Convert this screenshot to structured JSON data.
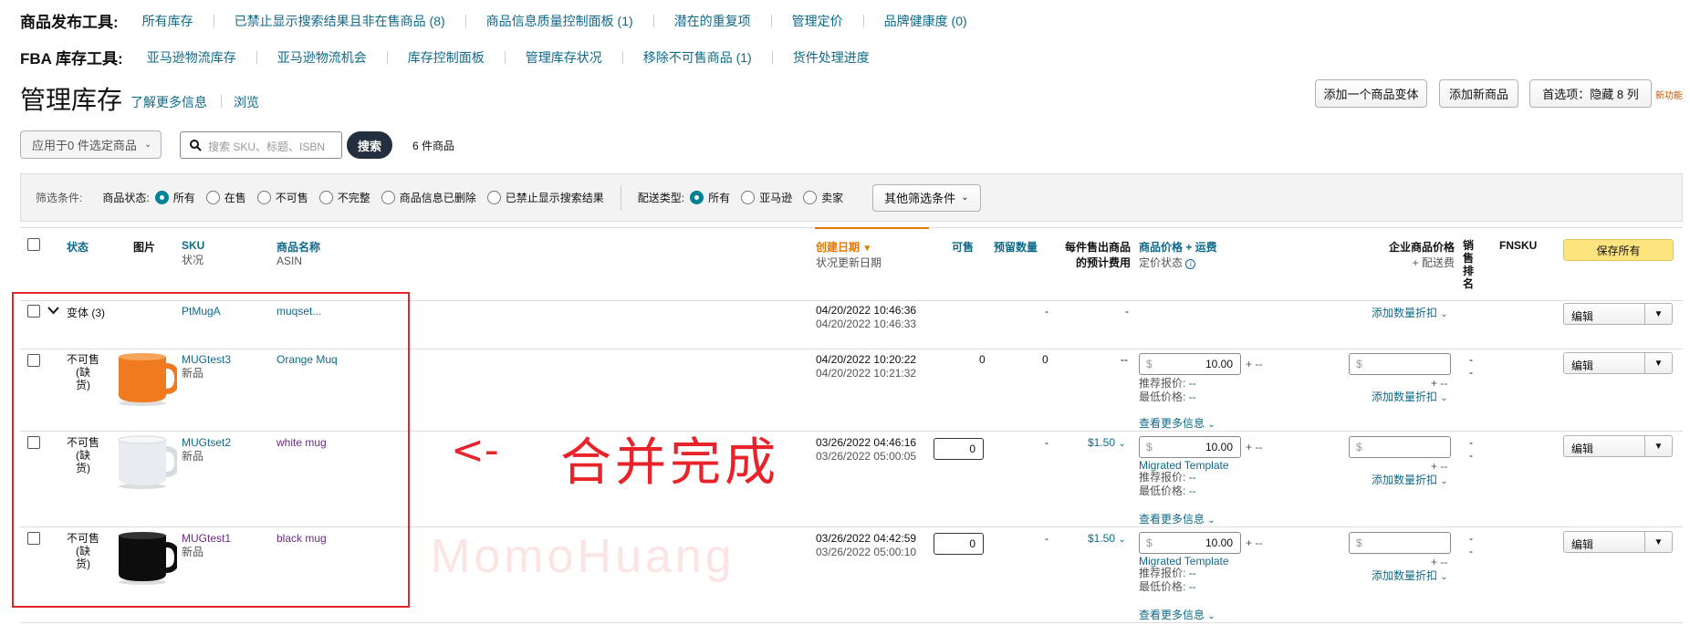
{
  "publish_tools": {
    "title": "商品发布工具:",
    "links": [
      "所有库存",
      "已禁止显示搜索结果且非在售商品 (8)",
      "商品信息质量控制面板 (1)",
      "潜在的重复项",
      "管理定价",
      "品牌健康度 (0)"
    ]
  },
  "fba_tools": {
    "title": "FBA 库存工具:",
    "links": [
      "亚马逊物流库存",
      "亚马逊物流机会",
      "库存控制面板",
      "管理库存状况",
      "移除不可售商品 (1)",
      "货件处理进度"
    ]
  },
  "page": {
    "title": "管理库存",
    "learn_more": "了解更多信息",
    "browse": "浏览",
    "btn_add_variation": "添加一个商品变体",
    "btn_add_product": "添加新商品",
    "btn_prefs": "首选项：隐藏 8 列",
    "new_feature": "新功能"
  },
  "search": {
    "apply_label": "应用于0 件选定商品",
    "placeholder": "搜索 SKU、标题、ISBN",
    "button": "搜索",
    "count": "6 件商品"
  },
  "filters": {
    "label": "筛选条件:",
    "status_label": "商品状态:",
    "status_options": [
      "所有",
      "在售",
      "不可售",
      "不完整",
      "商品信息已删除",
      "已禁止显示搜索结果"
    ],
    "fulfill_label": "配送类型:",
    "fulfill_options": [
      "所有",
      "亚马逊",
      "卖家"
    ],
    "more": "其他筛选条件"
  },
  "headers": {
    "status": "状态",
    "image": "图片",
    "sku": "SKU",
    "sku_sub": "状况",
    "name": "商品名称",
    "name_sub": "ASIN",
    "created": "创建日期",
    "created_sub": "状况更新日期",
    "available": "可售",
    "reserved": "预留数量",
    "fee_l1": "每件售出商品",
    "fee_l2": "的预计费用",
    "price": "商品价格 + 运费",
    "price_sub": "定价状态",
    "biz_price": "企业商品价格",
    "biz_sub": "+ 配送费",
    "rank_l1": "销",
    "rank_l2": "售",
    "rank_l3": "排",
    "rank_l4": "名",
    "fnsku": "FNSKU",
    "save_all": "保存所有"
  },
  "parent_row": {
    "status": "变体 (3)",
    "sku": "PtMugA",
    "name": "muqset...",
    "created": "04/20/2022 10:46:36",
    "updated": "04/20/2022 10:46:33",
    "reserved": "-",
    "fee": "-",
    "qty_discount": "添加数量折扣",
    "edit": "编辑"
  },
  "rows": [
    {
      "status_l1": "不可售",
      "status_l2": "(缺",
      "status_l3": "货)",
      "sku": "MUGtest3",
      "cond": "新品",
      "name": "Orange Muq",
      "created": "04/20/2022 10:20:22",
      "updated": "04/20/2022 10:21:32",
      "available": "0",
      "reserved": "0",
      "fee": "--",
      "price": "10.00",
      "price_ship": "+ --",
      "template": "",
      "rec_label": "推荐报价:",
      "rec_val": "--",
      "low_label": "最低价格:",
      "low_val": "--",
      "more_info": "查看更多信息",
      "biz_ship": "+ --",
      "qty_discount": "添加数量折扣",
      "rank": "-",
      "rank2": "-",
      "edit": "编辑",
      "color": "#f07b1e"
    },
    {
      "status_l1": "不可售",
      "status_l2": "(缺",
      "status_l3": "货)",
      "sku": "MUGtset2",
      "cond": "新品",
      "name": "white mug",
      "created": "03/26/2022 04:46:16",
      "updated": "03/26/2022 05:00:05",
      "available": "0",
      "reserved": "-",
      "fee": "$1.50",
      "price": "10.00",
      "price_ship": "+ --",
      "template": "Migrated Template",
      "rec_label": "推荐报价:",
      "rec_val": "--",
      "low_label": "最低价格:",
      "low_val": "--",
      "more_info": "查看更多信息",
      "biz_ship": "+ --",
      "qty_discount": "添加数量折扣",
      "rank": "-",
      "rank2": "-",
      "edit": "编辑",
      "color": "#e8ebef"
    },
    {
      "status_l1": "不可售",
      "status_l2": "(缺",
      "status_l3": "货)",
      "sku": "MUGtest1",
      "cond": "新品",
      "name": "black mug",
      "created": "03/26/2022 04:42:59",
      "updated": "03/26/2022 05:00:10",
      "available": "0",
      "reserved": "-",
      "fee": "$1.50",
      "price": "10.00",
      "price_ship": "+ --",
      "template": "Migrated Template",
      "rec_label": "推荐报价:",
      "rec_val": "--",
      "low_label": "最低价格:",
      "low_val": "--",
      "more_info": "查看更多信息",
      "biz_ship": "+ --",
      "qty_discount": "添加数量折扣",
      "rank": "-",
      "rank2": "-",
      "edit": "编辑",
      "color": "#0d0d0d"
    }
  ],
  "annotation": {
    "arrow": "<-",
    "text": "合并完成",
    "watermark": "MomoHuang",
    "color": "#e8232a"
  },
  "currency": "$"
}
